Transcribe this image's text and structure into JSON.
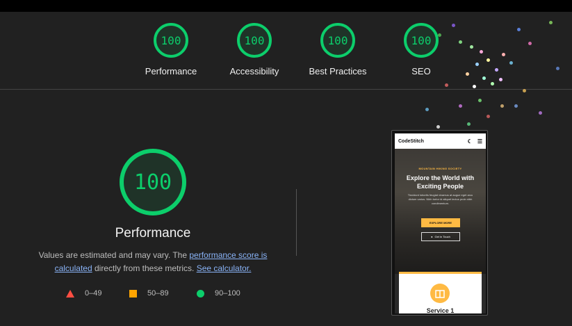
{
  "scores": [
    {
      "value": "100",
      "label": "Performance"
    },
    {
      "value": "100",
      "label": "Accessibility"
    },
    {
      "value": "100",
      "label": "Best Practices"
    },
    {
      "value": "100",
      "label": "SEO"
    }
  ],
  "main": {
    "score": "100",
    "title": "Performance",
    "desc_prefix": "Values are estimated and may vary. The ",
    "desc_link1": "performance score is calculated",
    "desc_middle": " directly from these metrics. ",
    "desc_link2": "See calculator."
  },
  "legend": {
    "fail": "0–49",
    "average": "50–89",
    "pass": "90–100"
  },
  "preview": {
    "logo": "CodeStitch",
    "kicker": "MOUNTAIN HIKING SOCIETY",
    "headline": "Explore the World with Exciting People",
    "body": "Tincidunt lobortis feugiat vivamus at augue eget arcu dictum varius. Nibh tortor id aliquet lectus proin nibh condimentum.",
    "primary_button": "EXPLORE MORE",
    "secondary_button": "Get in Touch",
    "card_title": "Service 1"
  },
  "colors": {
    "pass": "#0cce6b",
    "average": "#ffa400",
    "fail": "#ff4e42",
    "link": "#8ab4f8",
    "accent": "#ffba43"
  }
}
